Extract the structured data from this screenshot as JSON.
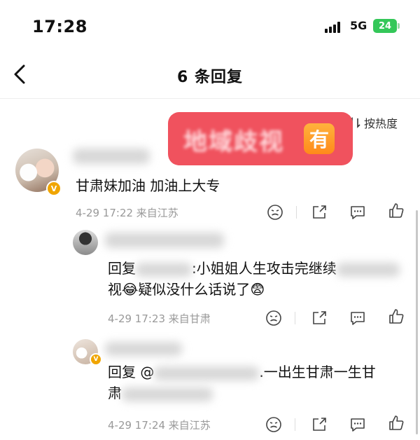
{
  "status": {
    "time": "17:28",
    "network": "5G",
    "battery": "24"
  },
  "header": {
    "title": "6 条回复"
  },
  "sort": {
    "label": "按热度"
  },
  "sticker": {
    "text": "地域歧视",
    "badge": "有"
  },
  "main_comment": {
    "text": "甘肃妹加油 加油上大专",
    "meta": "4-29 17:22 来自江苏"
  },
  "replies": [
    {
      "text_line1": "回复",
      "text_mid": ":小姐姐人生攻击完继续",
      "text_line2": "视",
      "text_tail": "疑似没什么话说了",
      "meta": "4-29 17:23 来自甘肃"
    },
    {
      "text_line1": "回复 @",
      "text_mid": ".一出生甘肃一生甘",
      "text_line2": "肃",
      "meta": "4-29 17:24 来自江苏"
    }
  ],
  "icons": {
    "emoji_laugh": "😂",
    "emoji_worried": "😨"
  }
}
